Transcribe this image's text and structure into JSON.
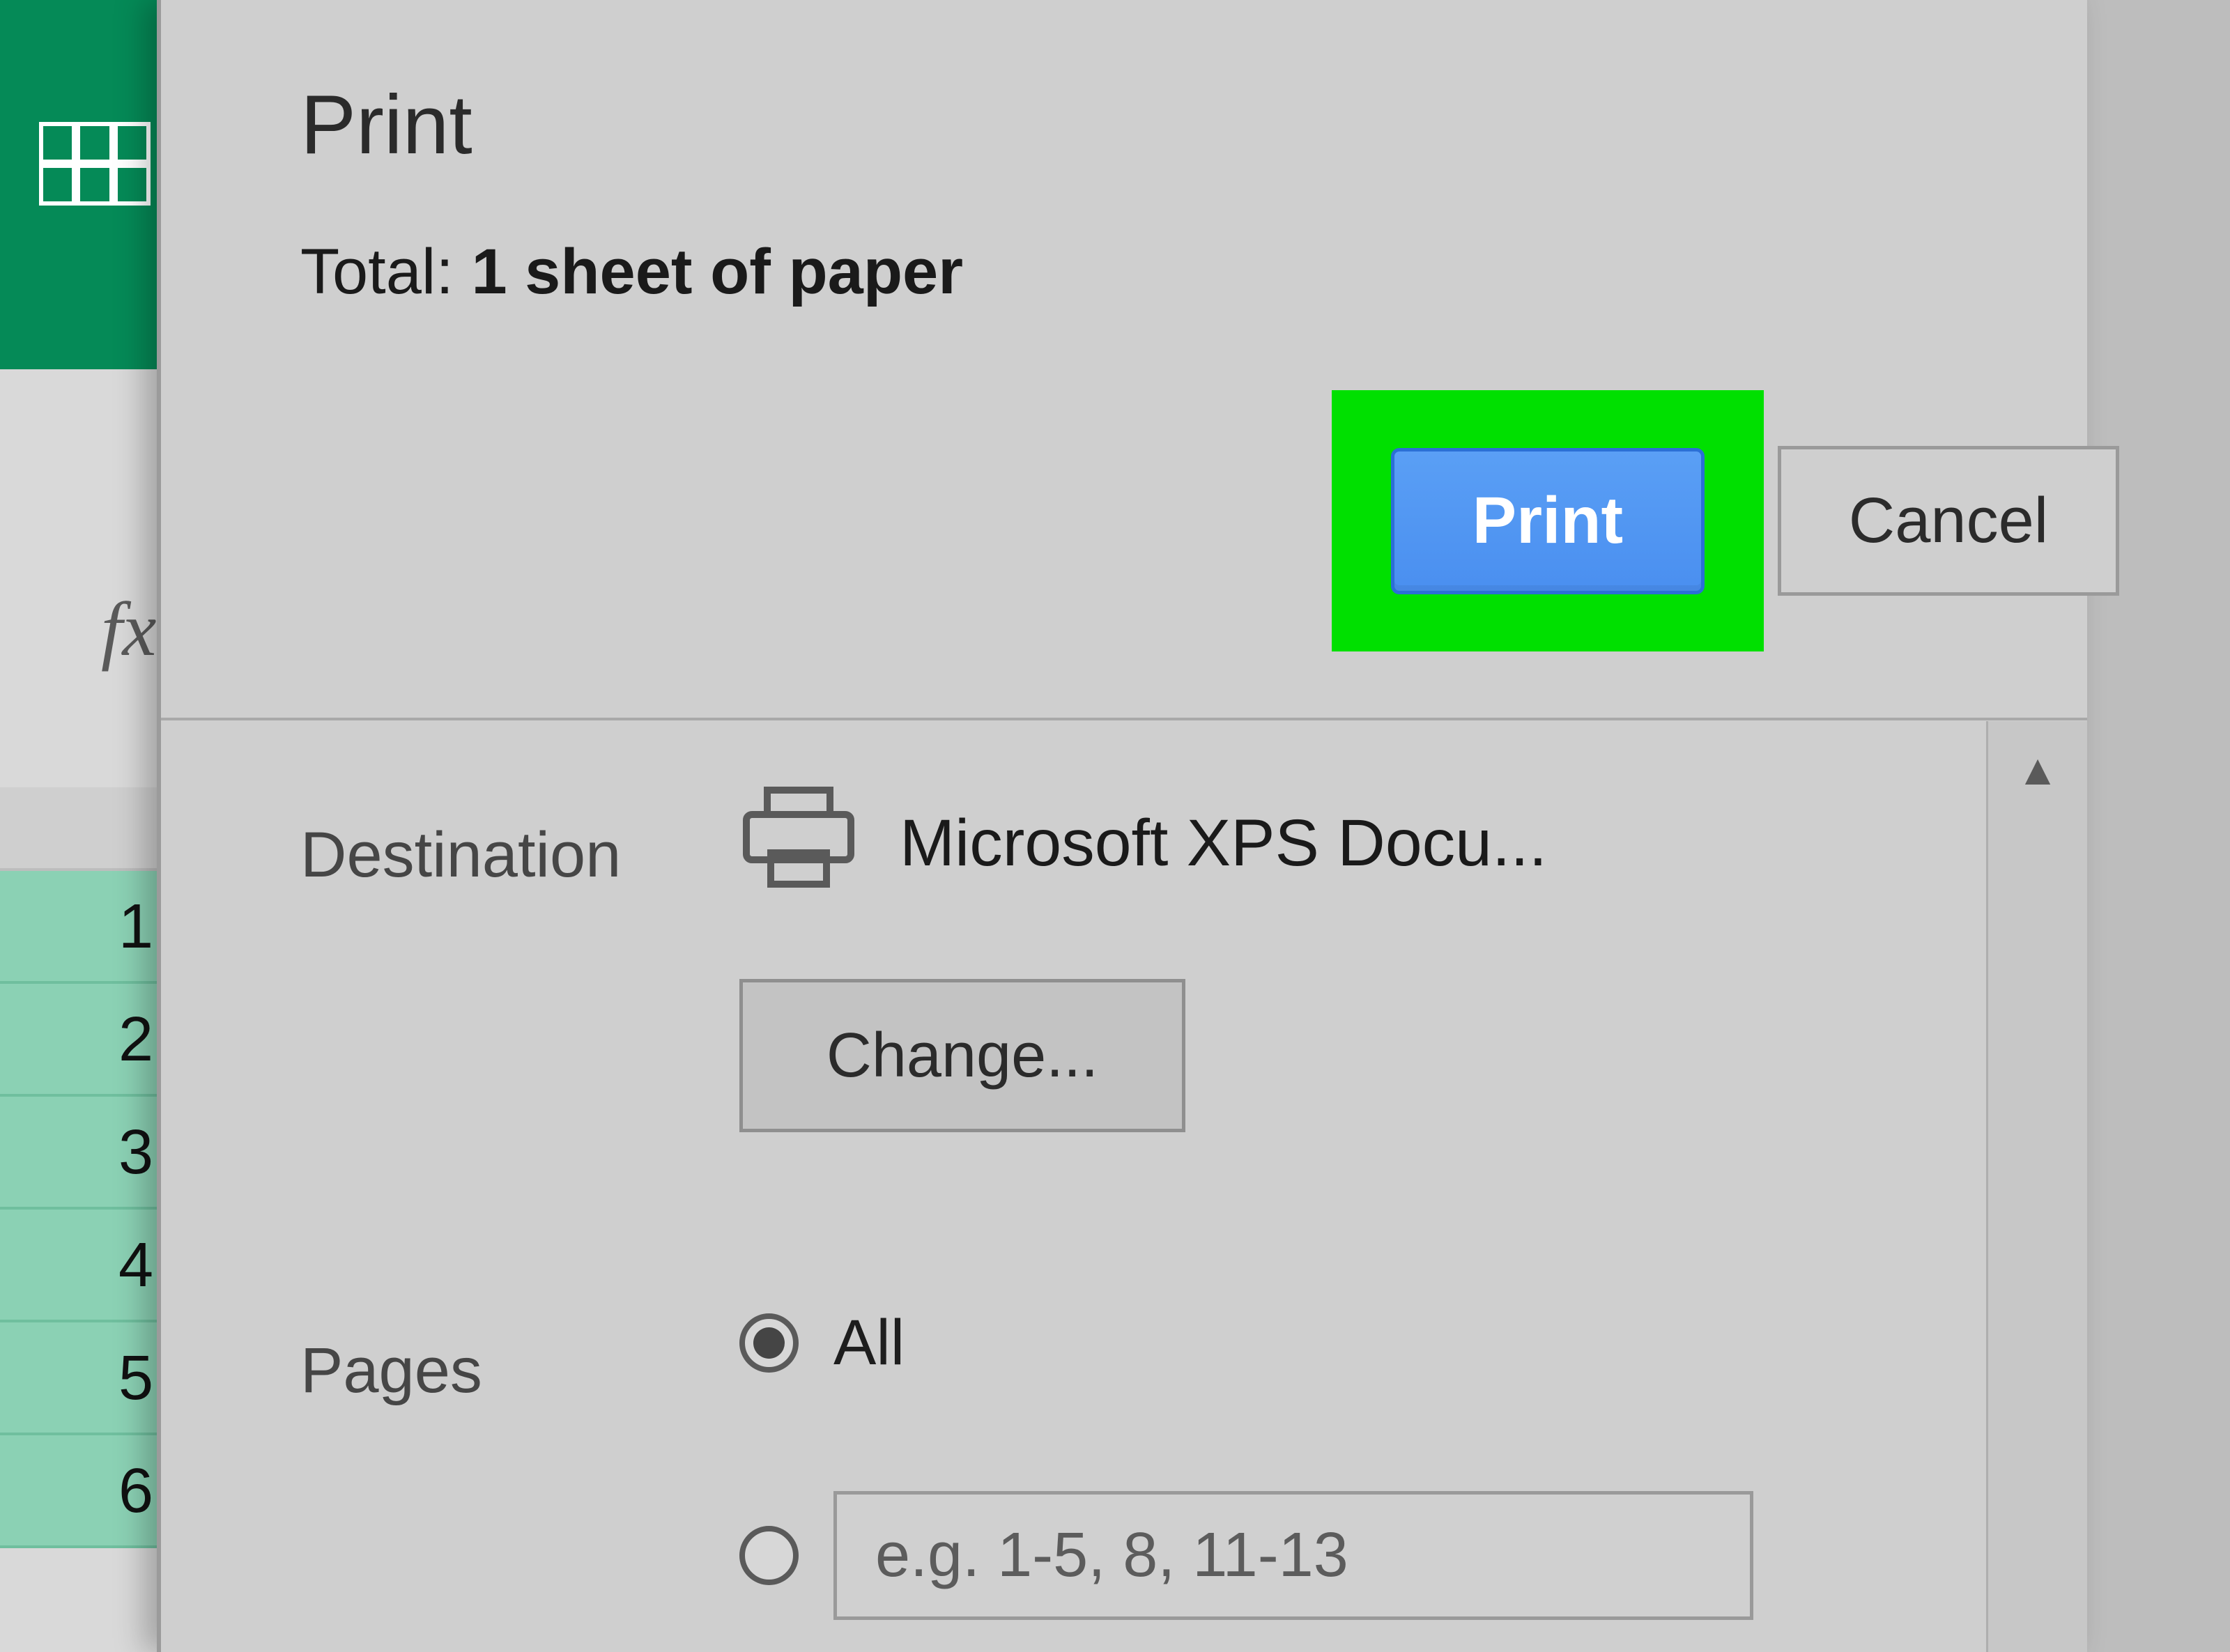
{
  "header": {
    "title": "Print",
    "total_prefix": "Total: ",
    "total_value": "1 sheet of paper"
  },
  "actions": {
    "print_label": "Print",
    "cancel_label": "Cancel"
  },
  "destination": {
    "label": "Destination",
    "printer_name": "Microsoft XPS Docu...",
    "change_label": "Change..."
  },
  "pages": {
    "label": "Pages",
    "all_label": "All",
    "range_placeholder": "e.g. 1-5, 8, 11-13"
  },
  "spreadsheet": {
    "fx": "fx",
    "rows": [
      "1",
      "2",
      "3",
      "4",
      "5",
      "6"
    ]
  },
  "highlight_color": "#00e000"
}
